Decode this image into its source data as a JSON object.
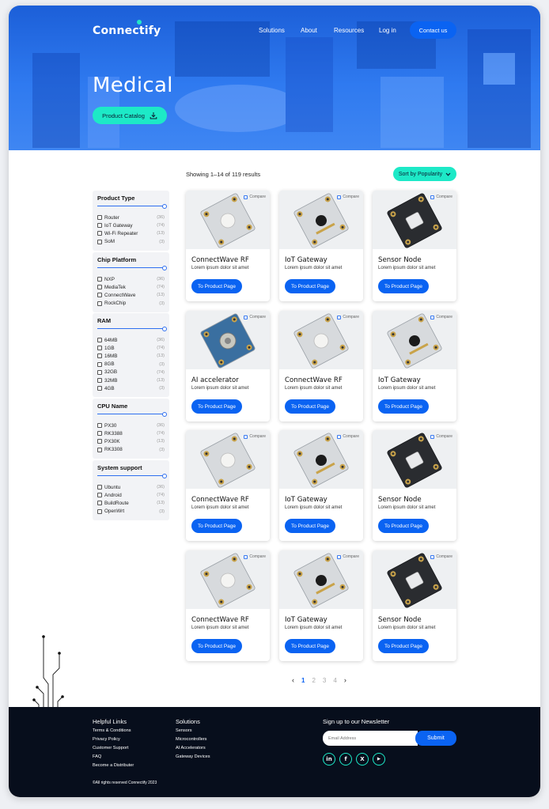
{
  "header": {
    "logo": "Connectify",
    "nav": [
      "Solutions",
      "About",
      "Resources",
      "Log in"
    ],
    "contact_label": "Contact us"
  },
  "hero": {
    "title": "Medical",
    "catalog_label": "Product Catalog"
  },
  "listing": {
    "results_text": "Showing 1–14 of 119 results",
    "sort_label": "Sort by Popularity"
  },
  "filters": [
    {
      "title": "Product Type",
      "options": [
        {
          "label": "Router",
          "count": "(36)"
        },
        {
          "label": "IoT Gateway",
          "count": "(74)"
        },
        {
          "label": "Wi-Fi Repeater",
          "count": "(13)"
        },
        {
          "label": "SoM",
          "count": "(3)"
        }
      ]
    },
    {
      "title": "Chip Platform",
      "options": [
        {
          "label": "NXP",
          "count": "(36)"
        },
        {
          "label": "MediaTek",
          "count": "(74)"
        },
        {
          "label": "ConnectWave",
          "count": "(13)"
        },
        {
          "label": "RockChip",
          "count": "(3)"
        }
      ]
    },
    {
      "title": "RAM",
      "options": [
        {
          "label": "64MB",
          "count": "(36)"
        },
        {
          "label": "1GB",
          "count": "(74)"
        },
        {
          "label": "16MB",
          "count": "(13)"
        },
        {
          "label": "8GB",
          "count": "(3)"
        },
        {
          "label": "32GB",
          "count": "(74)"
        },
        {
          "label": "32MB",
          "count": "(13)"
        },
        {
          "label": "4GB",
          "count": "(3)"
        }
      ]
    },
    {
      "title": "CPU Name",
      "options": [
        {
          "label": "PX30",
          "count": "(36)"
        },
        {
          "label": "RK3388",
          "count": "(74)"
        },
        {
          "label": "PX30K",
          "count": "(13)"
        },
        {
          "label": "RK3308",
          "count": "(3)"
        }
      ]
    },
    {
      "title": "System support",
      "options": [
        {
          "label": "Ubuntu",
          "count": "(36)"
        },
        {
          "label": "Android",
          "count": "(74)"
        },
        {
          "label": "BuildRoute",
          "count": "(13)"
        },
        {
          "label": "OpenWrt",
          "count": "(3)"
        }
      ]
    }
  ],
  "products": [
    {
      "name": "ConnectWave RF",
      "desc": "Lorem ipsum dolor sit amet",
      "button": "To Product Page",
      "compare": "Compare",
      "image": "rf-module"
    },
    {
      "name": "IoT Gateway",
      "desc": "Lorem ipsum dolor sit amet",
      "button": "To Product Page",
      "compare": "Compare",
      "image": "gateway-module"
    },
    {
      "name": "Sensor Node",
      "desc": "Lorem ipsum dolor sit amet",
      "button": "To Product Page",
      "compare": "Compare",
      "image": "sensor-module"
    },
    {
      "name": "AI accelerator",
      "desc": "Lorem ipsum dolor sit amet",
      "button": "To Product Page",
      "compare": "Compare",
      "image": "ai-module"
    },
    {
      "name": "ConnectWave RF",
      "desc": "Lorem ipsum dolor sit amet",
      "button": "To Product Page",
      "compare": "Compare",
      "image": "rf-module"
    },
    {
      "name": "IoT Gateway",
      "desc": "Lorem ipsum dolor sit amet",
      "button": "To Product Page",
      "compare": "Compare",
      "image": "gateway-module"
    },
    {
      "name": "ConnectWave RF",
      "desc": "Lorem ipsum dolor sit amet",
      "button": "To Product Page",
      "compare": "Compare",
      "image": "rf-module"
    },
    {
      "name": "IoT Gateway",
      "desc": "Lorem ipsum dolor sit amet",
      "button": "To Product Page",
      "compare": "Compare",
      "image": "gateway-module"
    },
    {
      "name": "Sensor Node",
      "desc": "Lorem ipsum dolor sit amet",
      "button": "To Product Page",
      "compare": "Compare",
      "image": "sensor-module"
    },
    {
      "name": "ConnectWave RF",
      "desc": "Lorem ipsum dolor sit amet",
      "button": "To Product Page",
      "compare": "Compare",
      "image": "rf-module"
    },
    {
      "name": "IoT Gateway",
      "desc": "Lorem ipsum dolor sit amet",
      "button": "To Product Page",
      "compare": "Compare",
      "image": "gateway-module"
    },
    {
      "name": "Sensor Node",
      "desc": "Lorem ipsum dolor sit amet",
      "button": "To Product Page",
      "compare": "Compare",
      "image": "sensor-module"
    }
  ],
  "pagination": {
    "pages": [
      "1",
      "2",
      "3",
      "4"
    ],
    "current": "1",
    "prev": "‹",
    "next": "›"
  },
  "footer": {
    "helpful_title": "Helpful Links",
    "helpful_links": [
      "Terms & Conditions",
      "Privacy Policy",
      "Customer Support",
      "FAQ",
      "Become a Distributer"
    ],
    "solutions_title": "Solutions",
    "solutions_links": [
      "Sensors",
      "Microcontrollers",
      "AI Accelerators",
      "Gateway Devices"
    ],
    "newsletter_title": "Sign up to our Newsletter",
    "email_placeholder": "Email Address",
    "submit_label": "Submit",
    "social": [
      {
        "icon": "linkedin-icon",
        "glyph": "in"
      },
      {
        "icon": "facebook-icon",
        "glyph": "f"
      },
      {
        "icon": "x-icon",
        "glyph": "X"
      },
      {
        "icon": "youtube-icon",
        "glyph": "▶"
      }
    ],
    "copyright": "©All rights reserved Connectify 2023"
  },
  "colors": {
    "accent": "#1de9c7",
    "primary": "#0a63f2",
    "hero": "#2f7af0",
    "footer": "#070e1c"
  }
}
